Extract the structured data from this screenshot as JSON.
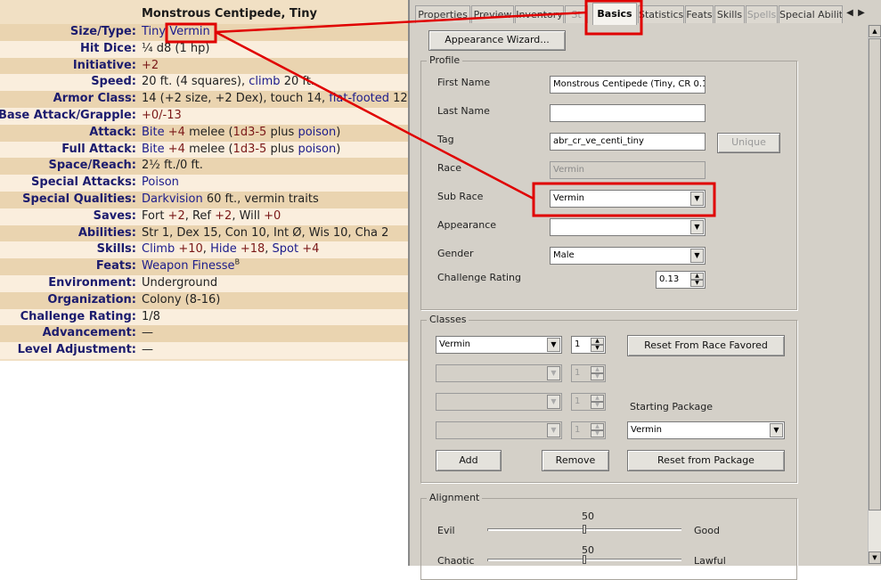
{
  "statblock": {
    "title": "Monstrous Centipede, Tiny",
    "rows": [
      {
        "label": "Size/Type:",
        "parts": [
          {
            "t": "Tiny ",
            "c": "lnk"
          },
          {
            "t": "Vermin",
            "c": "lnk"
          }
        ]
      },
      {
        "label": "Hit Dice:",
        "parts": [
          {
            "t": "¼ d8 (1 hp)"
          }
        ]
      },
      {
        "label": "Initiative:",
        "parts": [
          {
            "t": "+2",
            "c": "num"
          }
        ]
      },
      {
        "label": "Speed:",
        "parts": [
          {
            "t": "20 ft. (4 squares), "
          },
          {
            "t": "climb",
            "c": "lnk"
          },
          {
            "t": " 20 ft."
          }
        ]
      },
      {
        "label": "Armor Class:",
        "parts": [
          {
            "t": "14 (+2 size, +2 Dex), touch 14, "
          },
          {
            "t": "flat-footed",
            "c": "lnk"
          },
          {
            "t": " 12"
          }
        ]
      },
      {
        "label": "Base Attack/Grapple:",
        "parts": [
          {
            "t": "+0/-13",
            "c": "num"
          }
        ]
      },
      {
        "label": "Attack:",
        "parts": [
          {
            "t": "Bite ",
            "c": "lnk"
          },
          {
            "t": "+4",
            "c": "num"
          },
          {
            "t": " melee ("
          },
          {
            "t": "1d3-5",
            "c": "num"
          },
          {
            "t": " plus "
          },
          {
            "t": "poison",
            "c": "lnk"
          },
          {
            "t": ")"
          }
        ]
      },
      {
        "label": "Full Attack:",
        "parts": [
          {
            "t": "Bite ",
            "c": "lnk"
          },
          {
            "t": "+4",
            "c": "num"
          },
          {
            "t": " melee ("
          },
          {
            "t": "1d3-5",
            "c": "num"
          },
          {
            "t": " plus "
          },
          {
            "t": "poison",
            "c": "lnk"
          },
          {
            "t": ")"
          }
        ]
      },
      {
        "label": "Space/Reach:",
        "parts": [
          {
            "t": "2½ ft./0 ft."
          }
        ]
      },
      {
        "label": "Special Attacks:",
        "parts": [
          {
            "t": "Poison",
            "c": "lnk"
          }
        ]
      },
      {
        "label": "Special Qualities:",
        "parts": [
          {
            "t": "Darkvision",
            "c": "lnk"
          },
          {
            "t": " 60 ft., vermin traits"
          }
        ]
      },
      {
        "label": "Saves:",
        "parts": [
          {
            "t": "Fort "
          },
          {
            "t": "+2",
            "c": "num"
          },
          {
            "t": ", Ref "
          },
          {
            "t": "+2",
            "c": "num"
          },
          {
            "t": ", Will "
          },
          {
            "t": "+0",
            "c": "num"
          }
        ]
      },
      {
        "label": "Abilities:",
        "parts": [
          {
            "t": "Str 1, Dex 15, Con 10, Int Ø, Wis 10, Cha 2"
          }
        ]
      },
      {
        "label": "Skills:",
        "parts": [
          {
            "t": "Climb",
            "c": "lnk"
          },
          {
            "t": " +10",
            "c": "num"
          },
          {
            "t": ", "
          },
          {
            "t": "Hide",
            "c": "lnk"
          },
          {
            "t": " +18",
            "c": "num"
          },
          {
            "t": ", "
          },
          {
            "t": "Spot",
            "c": "lnk"
          },
          {
            "t": " +4",
            "c": "num"
          }
        ]
      },
      {
        "label": "Feats:",
        "parts": [
          {
            "t": "Weapon Finesse",
            "c": "lnk"
          },
          {
            "t": "B",
            "c": "sup"
          }
        ]
      },
      {
        "label": "Environment:",
        "parts": [
          {
            "t": "Underground"
          }
        ]
      },
      {
        "label": "Organization:",
        "parts": [
          {
            "t": "Colony (8-16)"
          }
        ]
      },
      {
        "label": "Challenge Rating:",
        "parts": [
          {
            "t": "1/8"
          }
        ]
      },
      {
        "label": "Advancement:",
        "parts": [
          {
            "t": "—"
          }
        ]
      },
      {
        "label": "Level Adjustment:",
        "parts": [
          {
            "t": "—"
          }
        ]
      }
    ]
  },
  "tabs": {
    "items": [
      {
        "label": "Properties",
        "state": "normal"
      },
      {
        "label": "Preview",
        "state": "normal"
      },
      {
        "label": "Inventory",
        "state": "normal"
      },
      {
        "label": "St",
        "state": "dim"
      },
      {
        "label": "Basics",
        "state": "active"
      },
      {
        "label": "Statistics",
        "state": "normal"
      },
      {
        "label": "Feats",
        "state": "normal"
      },
      {
        "label": "Skills",
        "state": "normal"
      },
      {
        "label": "Spells",
        "state": "dim"
      },
      {
        "label": "Special Abilit",
        "state": "normal"
      }
    ],
    "arrow_left": "◀",
    "arrow_right": "▶"
  },
  "basics": {
    "appearance_wizard": "Appearance Wizard...",
    "profile": {
      "title": "Profile",
      "first_name_label": "First Name",
      "first_name": "Monstrous Centipede (Tiny, CR 0.1",
      "last_name_label": "Last Name",
      "last_name": "",
      "tag_label": "Tag",
      "tag": "abr_cr_ve_centi_tiny",
      "unique_label": "Unique",
      "race_label": "Race",
      "race": "Vermin",
      "subrace_label": "Sub Race",
      "subrace": "Vermin",
      "appearance_label": "Appearance",
      "appearance": "",
      "gender_label": "Gender",
      "gender": "Male",
      "cr_label": "Challenge Rating",
      "cr": "0.13"
    },
    "classes": {
      "title": "Classes",
      "class1": "Vermin",
      "level1": "1",
      "level_disabled": "1",
      "reset_race": "Reset From Race Favored",
      "starting_package_label": "Starting Package",
      "starting_package": "Vermin",
      "add": "Add",
      "remove": "Remove",
      "reset_package": "Reset from Package"
    },
    "alignment": {
      "title": "Alignment",
      "evil": "Evil",
      "good": "Good",
      "chaotic": "Chaotic",
      "lawful": "Lawful",
      "good_evil_value": "50",
      "law_chaos_value": "50",
      "good_evil_fraction": 0.5,
      "law_chaos_fraction": 0.5
    }
  },
  "icons": {
    "dropdown": "▼",
    "spin_up": "▲",
    "spin_down": "▼"
  },
  "annotation_color": "#e00000"
}
